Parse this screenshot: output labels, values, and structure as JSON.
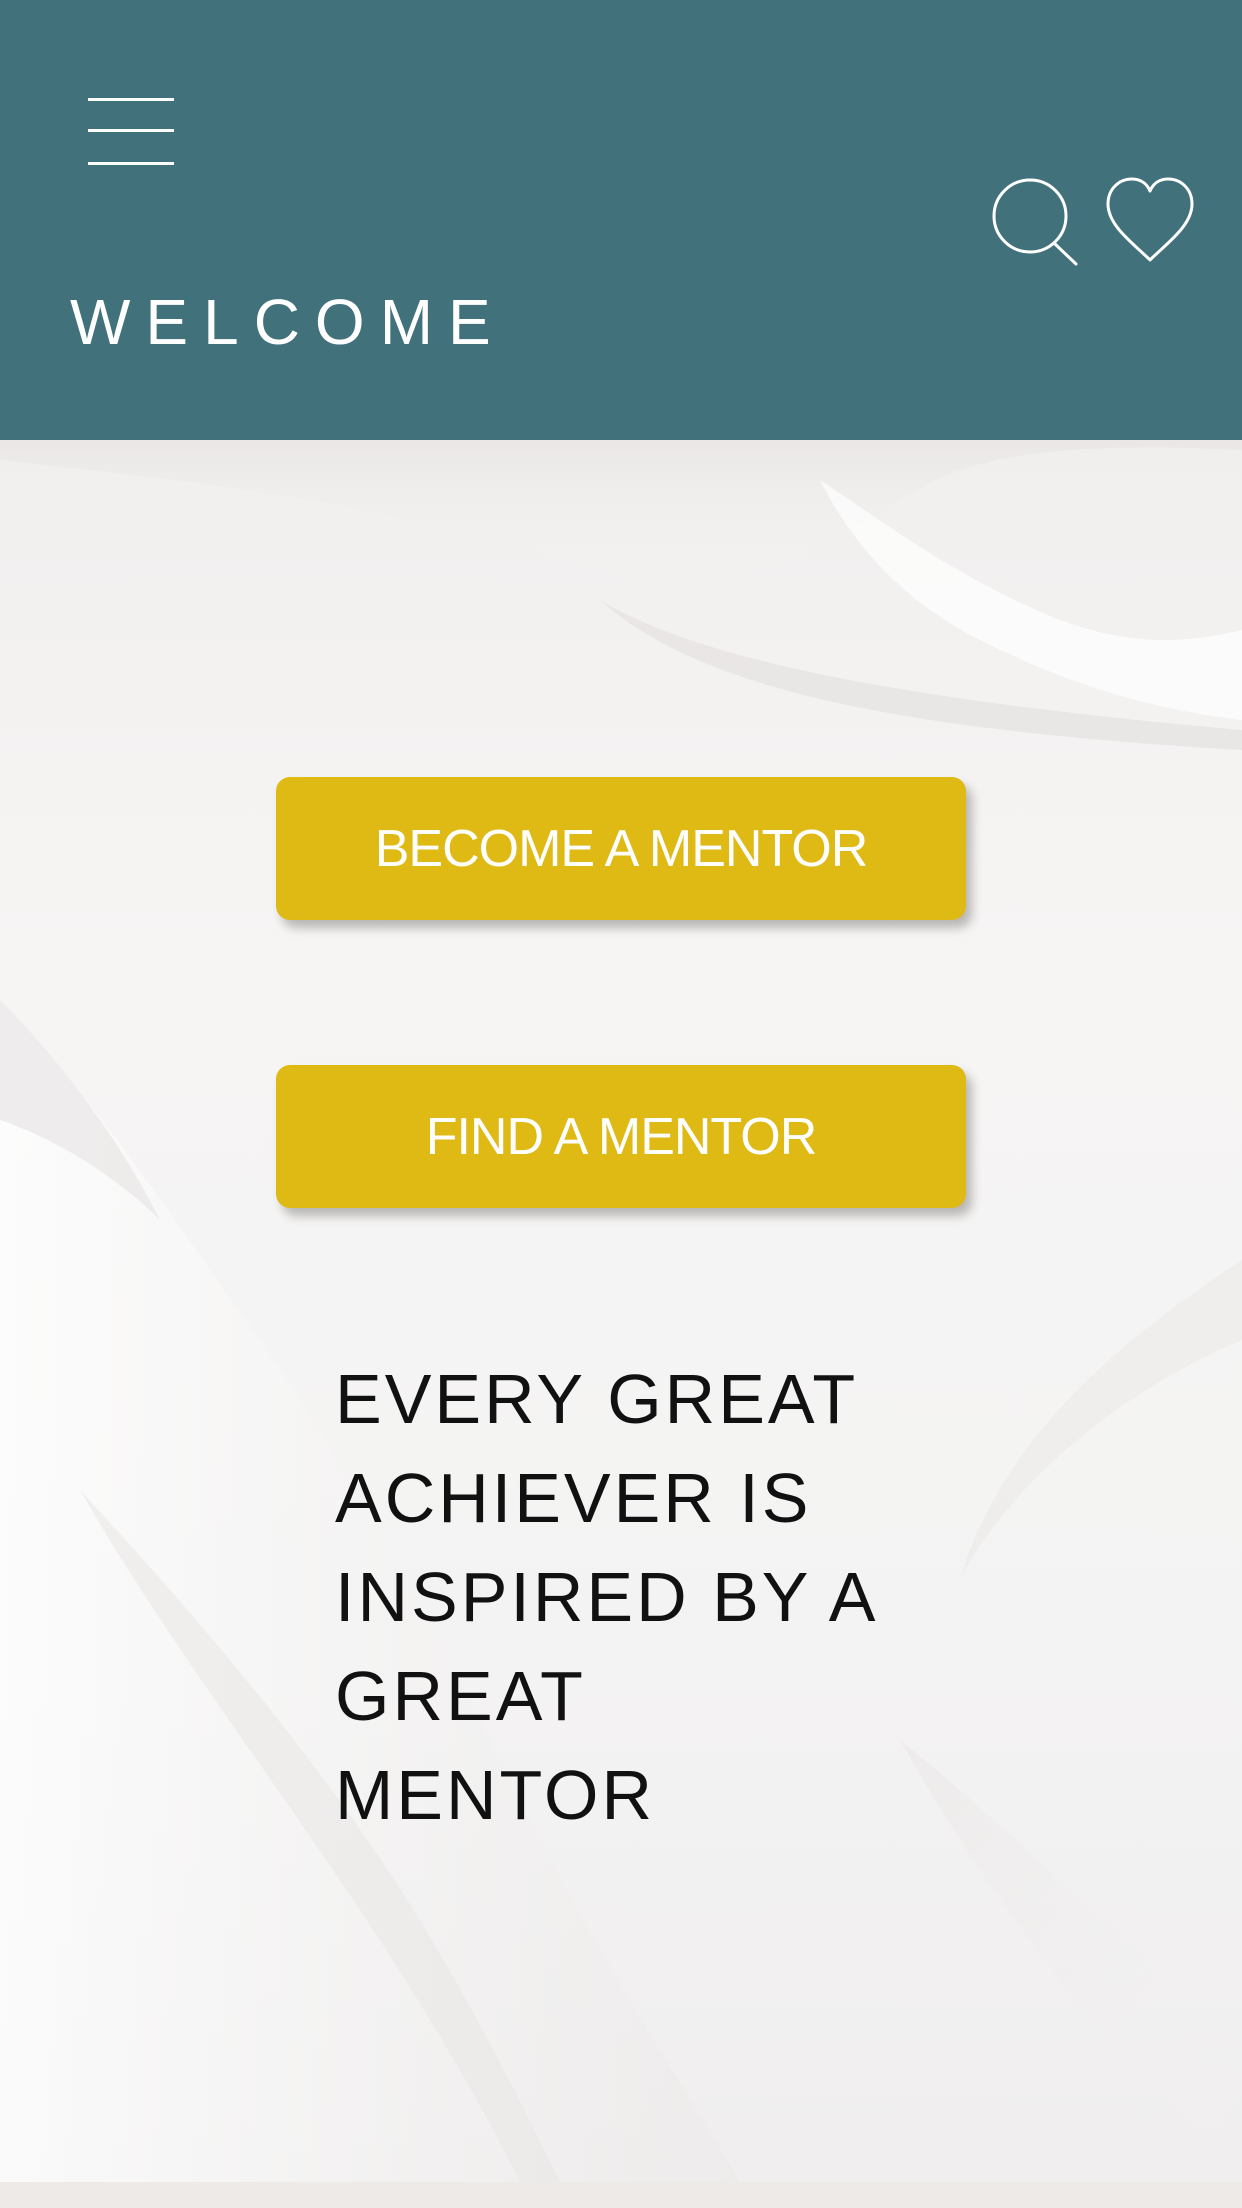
{
  "header": {
    "title": "WELCOME",
    "menu_icon": "hamburger-menu-icon",
    "search_icon": "search-icon",
    "favorite_icon": "heart-icon",
    "background_color": "#41727c"
  },
  "main": {
    "buttons": [
      {
        "label": "BECOME A MENTOR"
      },
      {
        "label": "FIND A MENTOR"
      }
    ],
    "button_color": "#dfb914",
    "quote_lines": [
      "EVERY GREAT",
      "ACHIEVER IS",
      "INSPIRED BY A",
      "GREAT",
      "MENTOR"
    ]
  }
}
